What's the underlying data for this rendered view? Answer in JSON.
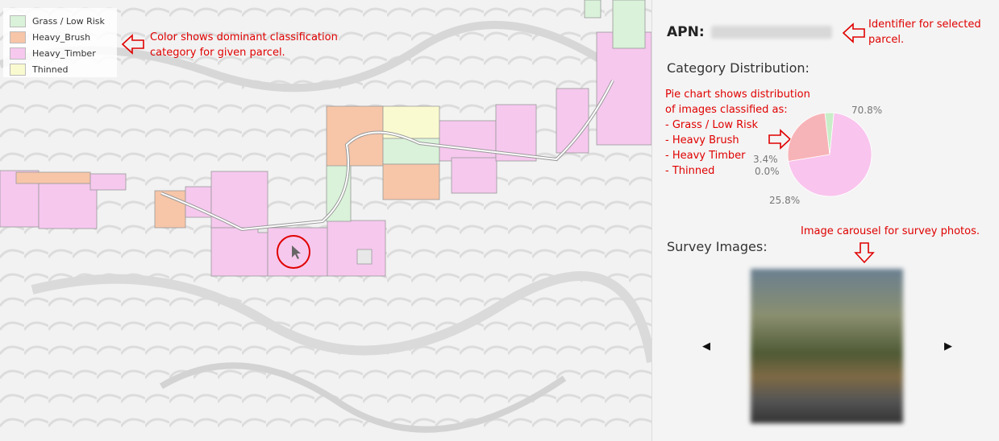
{
  "legend": {
    "items": [
      {
        "label": "Grass / Low Risk",
        "color": "#d9f2d9"
      },
      {
        "label": "Heavy_Brush",
        "color": "#f7c5a8"
      },
      {
        "label": "Heavy_Timber",
        "color": "#f6c8ee"
      },
      {
        "label": "Thinned",
        "color": "#fafad0"
      }
    ]
  },
  "annotations": {
    "legend_note_1": "Color shows dominant classification",
    "legend_note_2": "category for given parcel.",
    "apn_note_1": "Identifier for selected",
    "apn_note_2": "parcel.",
    "pie_note": [
      "Pie chart shows distribution",
      "of images classified as:",
      "- Grass / Low Risk",
      "- Heavy Brush",
      "- Heavy Timber",
      "- Thinned"
    ],
    "carousel_note": "Image carousel for survey photos."
  },
  "panel": {
    "apn_label": "APN:",
    "category_title": "Category Distribution:",
    "survey_title": "Survey Images:",
    "prev_label": "◀",
    "next_label": "▶"
  },
  "chart_data": {
    "type": "pie",
    "values": [
      {
        "category": "Grass / Low Risk",
        "percent": 3.4,
        "color": "#c8eec8"
      },
      {
        "category": "Heavy_Brush",
        "percent": 25.8,
        "color": "#f7b4b8"
      },
      {
        "category": "Heavy_Timber",
        "percent": 70.8,
        "color": "#f9c4ee"
      },
      {
        "category": "Thinned",
        "percent": 0.0,
        "color": "#fafad0"
      }
    ],
    "labels": [
      "70.8%",
      "3.4%",
      "0.0%",
      "25.8%"
    ]
  }
}
